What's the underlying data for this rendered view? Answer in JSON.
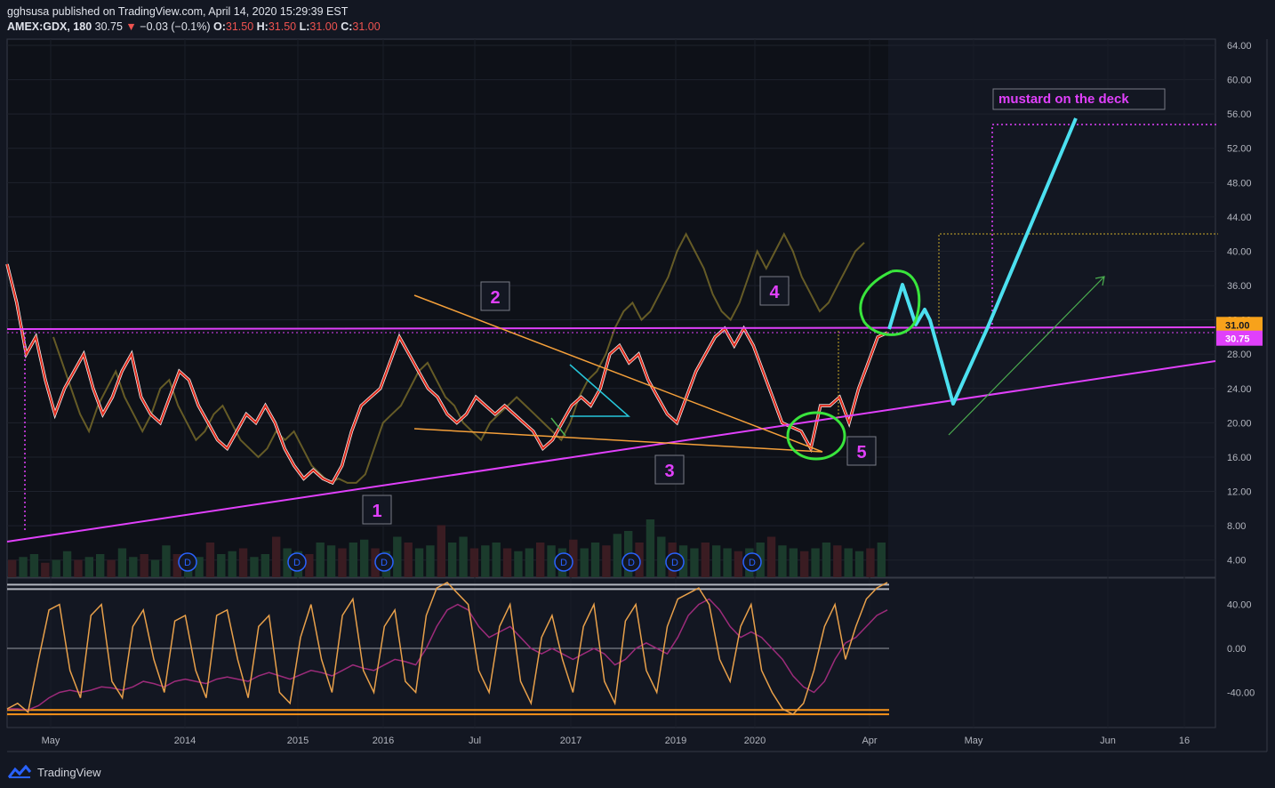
{
  "header": {
    "published_line": "gghsusa published on TradingView.com, April 14, 2020 15:29:39 EST",
    "symbol": "AMEX:GDX, 180",
    "last": "30.75",
    "change": "−0.03 (−0.1%)",
    "o_label": "O:",
    "o": "31.50",
    "h_label": "H:",
    "h": "31.50",
    "l_label": "L:",
    "l": "31.00",
    "c_label": "C:",
    "c": "31.00"
  },
  "footer": {
    "brand": "TradingView"
  },
  "annotations": {
    "wave1": "1",
    "wave2": "2",
    "wave3": "3",
    "wave4": "4",
    "wave5": "5",
    "target_note": "mustard on the deck",
    "dividend_marker": "D"
  },
  "chart_data": [
    {
      "type": "line",
      "title": "",
      "y_axis": {
        "ticks": [
          4,
          8,
          12,
          16,
          20,
          24,
          28,
          32,
          36,
          40,
          44,
          48,
          52,
          56,
          60,
          64
        ],
        "labels": [
          "4.00",
          "8.00",
          "12.00",
          "16.00",
          "20.00",
          "24.00",
          "28.00",
          "32.00",
          "36.00",
          "40.00",
          "44.00",
          "48.00",
          "52.00",
          "56.00",
          "60.00",
          "64.00"
        ],
        "range": [
          2,
          65
        ]
      },
      "x_axis": {
        "labels": [
          "May",
          "2014",
          "2015",
          "2016",
          "Jul",
          "2017",
          "2019",
          "2020",
          "Apr",
          "May",
          "Jun",
          "16"
        ]
      },
      "price_labels": [
        {
          "value": 31.0,
          "text": "31.00",
          "color": "#f7a21b"
        },
        {
          "value": 30.75,
          "text": "30.75",
          "color": "#e040fb"
        }
      ],
      "series": [
        {
          "values": [
            38.5,
            34,
            28,
            30,
            25,
            21,
            24,
            26,
            28,
            24,
            21,
            23,
            26,
            28,
            23,
            21,
            20,
            23,
            26,
            25,
            22,
            20,
            18,
            17,
            19,
            21,
            20,
            22,
            20,
            17,
            15,
            13.5,
            14.5,
            13.5,
            13,
            15,
            19,
            22,
            23,
            24,
            27,
            30,
            28,
            26,
            24,
            23,
            21,
            20,
            21,
            23,
            22,
            21,
            22,
            21,
            20,
            19,
            17,
            18,
            20,
            22,
            23,
            22,
            24,
            28,
            29,
            27,
            28,
            25,
            23,
            21,
            20,
            23,
            26,
            28,
            30,
            31,
            29,
            31,
            29,
            26,
            23,
            20,
            19.5,
            19,
            17,
            22,
            22,
            23,
            20,
            24,
            27,
            30,
            30.5
          ]
        },
        {
          "values": [
            30,
            27,
            24,
            21,
            19,
            22,
            24,
            26,
            23,
            21,
            19,
            21,
            24,
            25,
            22,
            20,
            18,
            19,
            21,
            22,
            20,
            18,
            17,
            16,
            17,
            19,
            18,
            19,
            17,
            15,
            14,
            13,
            13.5,
            13,
            13,
            14,
            17,
            20,
            21,
            22,
            24,
            26,
            27,
            25,
            23,
            22,
            20,
            19,
            18,
            20,
            21,
            22,
            23,
            22,
            21,
            20,
            19,
            18,
            20,
            23,
            25,
            26,
            28,
            31,
            33,
            34,
            32,
            33,
            35,
            37,
            40,
            42,
            40,
            38,
            35,
            33,
            32,
            34,
            37,
            40,
            38,
            40,
            42,
            40,
            37,
            35,
            33,
            34,
            36,
            38,
            40,
            41
          ]
        }
      ],
      "volume_bars": [
        0.3,
        0.35,
        0.4,
        0.25,
        0.3,
        0.45,
        0.3,
        0.35,
        0.4,
        0.3,
        0.5,
        0.35,
        0.4,
        0.3,
        0.55,
        0.4,
        0.3,
        0.35,
        0.6,
        0.4,
        0.45,
        0.5,
        0.35,
        0.4,
        0.7,
        0.5,
        0.45,
        0.4,
        0.6,
        0.55,
        0.5,
        0.6,
        0.65,
        0.5,
        0.45,
        0.7,
        0.6,
        0.5,
        0.55,
        0.9,
        0.6,
        0.7,
        0.5,
        0.55,
        0.6,
        0.5,
        0.45,
        0.5,
        0.6,
        0.55,
        0.5,
        0.65,
        0.5,
        0.6,
        0.55,
        0.75,
        0.8,
        0.6,
        1.0,
        0.7,
        0.6,
        0.55,
        0.5,
        0.6,
        0.55,
        0.5,
        0.45,
        0.5,
        0.6,
        0.7,
        0.55,
        0.5,
        0.45,
        0.5,
        0.6,
        0.55,
        0.5,
        0.45,
        0.5,
        0.6
      ]
    },
    {
      "type": "line",
      "title": "",
      "y_axis": {
        "ticks": [
          -40,
          0,
          40
        ],
        "labels": [
          "-40.00",
          "0.00",
          "40.00"
        ],
        "range": [
          -72,
          64
        ]
      },
      "levels": [
        54,
        58,
        -56,
        -60
      ],
      "series": [
        {
          "values": [
            -55,
            -50,
            -58,
            -10,
            35,
            40,
            -20,
            -45,
            30,
            40,
            -30,
            -45,
            20,
            35,
            -10,
            -40,
            25,
            30,
            -20,
            -45,
            30,
            35,
            -10,
            -45,
            20,
            30,
            -40,
            -50,
            10,
            40,
            -10,
            -40,
            30,
            45,
            -20,
            -40,
            20,
            35,
            -30,
            -40,
            30,
            55,
            60,
            50,
            40,
            -20,
            -40,
            20,
            40,
            -30,
            -50,
            10,
            30,
            -10,
            -40,
            20,
            40,
            -30,
            -50,
            25,
            40,
            -20,
            -40,
            20,
            45,
            50,
            55,
            40,
            -10,
            -30,
            20,
            40,
            -20,
            -40,
            -55,
            -60,
            -50,
            -20,
            20,
            40,
            -10,
            20,
            45,
            55,
            60
          ]
        },
        {
          "values": [
            -55,
            -55,
            -56,
            -52,
            -45,
            -40,
            -38,
            -40,
            -38,
            -35,
            -36,
            -38,
            -35,
            -30,
            -32,
            -35,
            -30,
            -28,
            -30,
            -32,
            -28,
            -26,
            -28,
            -30,
            -25,
            -22,
            -25,
            -28,
            -24,
            -20,
            -22,
            -25,
            -20,
            -15,
            -18,
            -20,
            -15,
            -10,
            -12,
            -15,
            0,
            20,
            35,
            40,
            35,
            20,
            10,
            15,
            20,
            10,
            0,
            -5,
            0,
            -5,
            -10,
            -5,
            0,
            -5,
            -15,
            -10,
            0,
            5,
            0,
            -5,
            10,
            30,
            40,
            45,
            35,
            20,
            10,
            15,
            10,
            0,
            -10,
            -25,
            -35,
            -40,
            -30,
            -10,
            5,
            10,
            20,
            30,
            35
          ]
        }
      ]
    }
  ]
}
